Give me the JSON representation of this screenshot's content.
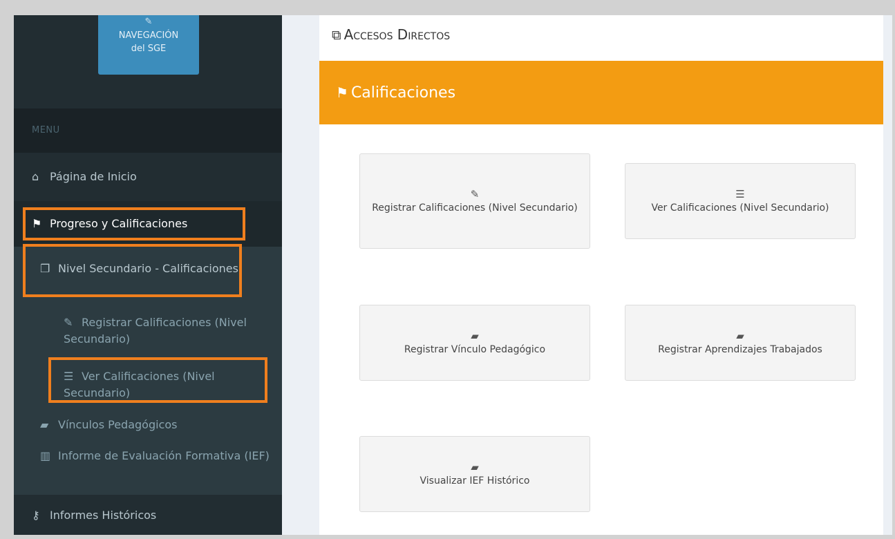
{
  "sidebar": {
    "nav_button": {
      "line1": "NAVEGACIÓN",
      "line2": "del SGE"
    },
    "menu_header": "MENU",
    "items": {
      "home": "Página de Inicio",
      "progress": "Progreso y Calificaciones",
      "nivel_secundario": "Nivel Secundario - Calificaciones",
      "registrar": "Registrar Calificaciones (Nivel Secundario)",
      "ver": "Ver Calificaciones (Nivel Secundario)",
      "vinculos": "Vínculos Pedagógicos",
      "ief": "Informe de Evaluación Formativa (IEF)",
      "historicos": "Informes Históricos"
    }
  },
  "content": {
    "header": "Accesos Directos",
    "section_title": "Calificaciones",
    "cards": {
      "registrar": "Registrar Calificaciones (Nivel Secundario)",
      "ver": "Ver Calificaciones (Nivel Secundario)",
      "vinculo": "Registrar Vínculo Pedagógico",
      "aprendizajes": "Registrar Aprendizajes Trabajados",
      "ief_historico": "Visualizar IEF Histórico"
    }
  },
  "colors": {
    "sidebar_bg": "#222d32",
    "accent_orange": "#f39c12",
    "highlight_border": "#f07f1e",
    "nav_button_blue": "#3c8dbc"
  },
  "icons": {
    "nav_button": "edit-icon",
    "home": "home-icon",
    "progress": "flag-checkered-icon",
    "nivel_secundario": "copy-icon",
    "registrar": "edit-icon",
    "ver": "list-ol-icon",
    "vinculos": "book-icon",
    "ief": "map-icon",
    "historicos": "key-icon",
    "header": "external-link-icon"
  }
}
